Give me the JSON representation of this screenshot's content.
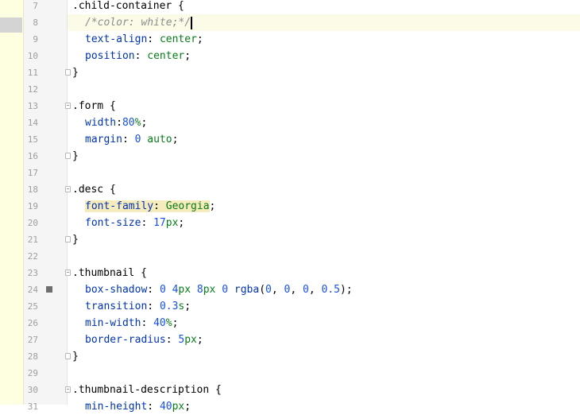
{
  "editor": {
    "current_line": "8",
    "lines": [
      {
        "n": "7",
        "tokens": [
          [
            "sel",
            ".child-container"
          ],
          [
            "punc",
            " {"
          ]
        ]
      },
      {
        "n": "8",
        "tokens": [
          [
            "cmt",
            "/*color: white;*/"
          ]
        ]
      },
      {
        "n": "9",
        "tokens": [
          [
            "prop",
            "text-align"
          ],
          [
            "punc",
            ": "
          ],
          [
            "val",
            "center"
          ],
          [
            "punc",
            ";"
          ]
        ]
      },
      {
        "n": "10",
        "tokens": [
          [
            "prop",
            "position"
          ],
          [
            "punc",
            ": "
          ],
          [
            "val",
            "center"
          ],
          [
            "punc",
            ";"
          ]
        ]
      },
      {
        "n": "11",
        "tokens": [
          [
            "punc",
            "}"
          ]
        ]
      },
      {
        "n": "12",
        "tokens": []
      },
      {
        "n": "13",
        "tokens": [
          [
            "sel",
            ".form"
          ],
          [
            "punc",
            " {"
          ]
        ]
      },
      {
        "n": "14",
        "tokens": [
          [
            "prop",
            "width"
          ],
          [
            "punc",
            ":"
          ],
          [
            "num",
            "80"
          ],
          [
            "unit",
            "%"
          ],
          [
            "punc",
            ";"
          ]
        ]
      },
      {
        "n": "15",
        "tokens": [
          [
            "prop",
            "margin"
          ],
          [
            "punc",
            ": "
          ],
          [
            "num",
            "0"
          ],
          [
            "punc",
            " "
          ],
          [
            "val",
            "auto"
          ],
          [
            "punc",
            ";"
          ]
        ]
      },
      {
        "n": "16",
        "tokens": [
          [
            "punc",
            "}"
          ]
        ]
      },
      {
        "n": "17",
        "tokens": []
      },
      {
        "n": "18",
        "tokens": [
          [
            "sel",
            ".desc"
          ],
          [
            "punc",
            " {"
          ]
        ]
      },
      {
        "n": "19",
        "tokens": [
          [
            "prop",
            "font-family"
          ],
          [
            "punc",
            ": "
          ],
          [
            "val",
            "Georgia"
          ],
          [
            "punc",
            ";"
          ]
        ]
      },
      {
        "n": "20",
        "tokens": [
          [
            "prop",
            "font-size"
          ],
          [
            "punc",
            ": "
          ],
          [
            "num",
            "17"
          ],
          [
            "unit",
            "px"
          ],
          [
            "punc",
            ";"
          ]
        ]
      },
      {
        "n": "21",
        "tokens": [
          [
            "punc",
            "}"
          ]
        ]
      },
      {
        "n": "22",
        "tokens": []
      },
      {
        "n": "23",
        "tokens": [
          [
            "sel",
            ".thumbnail"
          ],
          [
            "punc",
            " {"
          ]
        ]
      },
      {
        "n": "24",
        "tokens": [
          [
            "prop",
            "box-shadow"
          ],
          [
            "punc",
            ": "
          ],
          [
            "num",
            "0"
          ],
          [
            "punc",
            " "
          ],
          [
            "num",
            "4"
          ],
          [
            "unit",
            "px"
          ],
          [
            "punc",
            " "
          ],
          [
            "num",
            "8"
          ],
          [
            "unit",
            "px"
          ],
          [
            "punc",
            " "
          ],
          [
            "num",
            "0"
          ],
          [
            "punc",
            " "
          ],
          [
            "prop",
            "rgba"
          ],
          [
            "punc",
            "("
          ],
          [
            "num",
            "0"
          ],
          [
            "punc",
            ", "
          ],
          [
            "num",
            "0"
          ],
          [
            "punc",
            ", "
          ],
          [
            "num",
            "0"
          ],
          [
            "punc",
            ", "
          ],
          [
            "num",
            "0.5"
          ],
          [
            "punc",
            ");"
          ]
        ]
      },
      {
        "n": "25",
        "tokens": [
          [
            "prop",
            "transition"
          ],
          [
            "punc",
            ": "
          ],
          [
            "num",
            "0.3"
          ],
          [
            "unit",
            "s"
          ],
          [
            "punc",
            ";"
          ]
        ]
      },
      {
        "n": "26",
        "tokens": [
          [
            "prop",
            "min-width"
          ],
          [
            "punc",
            ": "
          ],
          [
            "num",
            "40"
          ],
          [
            "unit",
            "%"
          ],
          [
            "punc",
            ";"
          ]
        ]
      },
      {
        "n": "27",
        "tokens": [
          [
            "prop",
            "border-radius"
          ],
          [
            "punc",
            ": "
          ],
          [
            "num",
            "5"
          ],
          [
            "unit",
            "px"
          ],
          [
            "punc",
            ";"
          ]
        ]
      },
      {
        "n": "28",
        "tokens": [
          [
            "punc",
            "}"
          ]
        ]
      },
      {
        "n": "29",
        "tokens": []
      },
      {
        "n": "30",
        "tokens": [
          [
            "sel",
            ".thumbnail-description"
          ],
          [
            "punc",
            " {"
          ]
        ]
      },
      {
        "n": "31",
        "tokens": [
          [
            "prop",
            "min-height"
          ],
          [
            "punc",
            ": "
          ],
          [
            "num",
            "40"
          ],
          [
            "unit",
            "px"
          ],
          [
            "punc",
            ";"
          ]
        ]
      }
    ]
  },
  "colors": {
    "property": "#0033b3",
    "value": "#067d17",
    "number": "#1750eb",
    "comment": "#8c8c8c",
    "highlight": "#f6ebbc",
    "current_line": "#fcfbe8"
  }
}
